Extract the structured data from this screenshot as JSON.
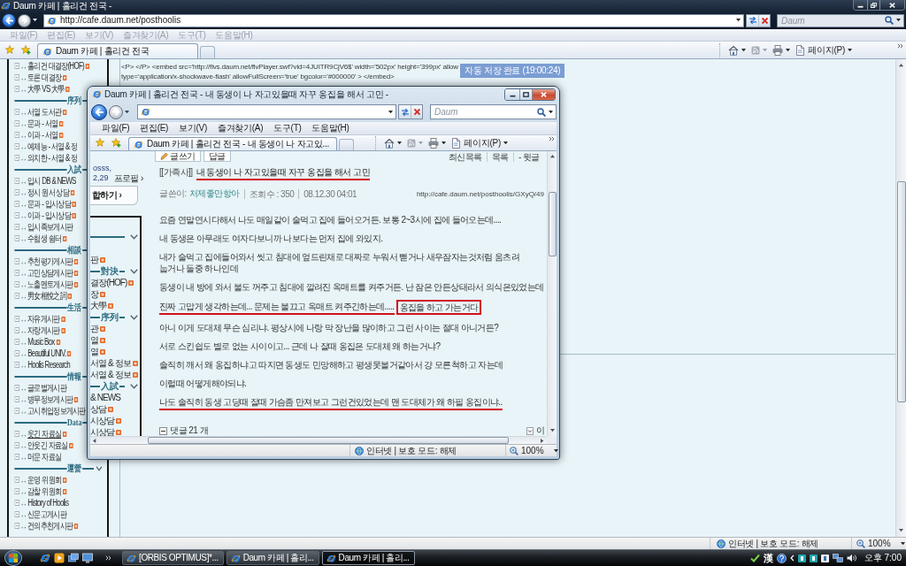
{
  "outer_window": {
    "title": "Daum 카페 | 홀리건 전국 -",
    "active": false,
    "address": "http://cafe.daum.net/posthoolis",
    "search_placeholder": "Daum",
    "menu": [
      "파일(F)",
      "편집(E)",
      "보기(V)",
      "즐겨찾기(A)",
      "도구(T)",
      "도움말(H)"
    ],
    "tabs": [
      {
        "label": "Daum 카페 | 홀리건 전국",
        "selected": true
      }
    ],
    "page_menu": "페이지(P)",
    "status": "인터넷 | 보호 모드: 해제",
    "zoom": "100%"
  },
  "cafe_sidebar": [
    {
      "kind": "link",
      "label": "홀리건 대결장(HOF)",
      "new": true,
      "hovered": false
    },
    {
      "kind": "link",
      "label": "토론 대결장",
      "new": true,
      "hovered": false
    },
    {
      "kind": "link",
      "label": "大學 VS 大學",
      "new": true,
      "hovered": false
    },
    {
      "kind": "section",
      "label": "序列",
      "toggle": false
    },
    {
      "kind": "link",
      "label": "서열 도서관",
      "new": true,
      "hovered": false
    },
    {
      "kind": "link",
      "label": "문과 - 서열",
      "new": true,
      "hovered": false
    },
    {
      "kind": "link",
      "label": "이과 - 서열",
      "new": true,
      "hovered": false
    },
    {
      "kind": "link",
      "label": "예체능 - 서열 & 정",
      "new": false,
      "hovered": false
    },
    {
      "kind": "link",
      "label": "의치한 - 서열 & 정",
      "new": false,
      "hovered": false
    },
    {
      "kind": "section",
      "label": "入試",
      "toggle": false
    },
    {
      "kind": "link",
      "label": "입시 DB & NEWS",
      "new": false,
      "hovered": false
    },
    {
      "kind": "link",
      "label": "정시 원서 상담",
      "new": true,
      "hovered": false
    },
    {
      "kind": "link",
      "label": "문과 - 입시상담",
      "new": true,
      "hovered": false
    },
    {
      "kind": "link",
      "label": "이과 - 입시상담",
      "new": true,
      "hovered": false
    },
    {
      "kind": "link",
      "label": "입시족보게시판",
      "new": false,
      "hovered": false
    },
    {
      "kind": "link",
      "label": "수험생 쉼터",
      "new": true,
      "hovered": false
    },
    {
      "kind": "section",
      "label": "相談",
      "toggle": false
    },
    {
      "kind": "link",
      "label": "추천평가게시판",
      "new": true,
      "hovered": false
    },
    {
      "kind": "link",
      "label": "고민상담게시판",
      "new": true,
      "hovered": false
    },
    {
      "kind": "link",
      "label": "노출멘토게시판",
      "new": true,
      "hovered": false
    },
    {
      "kind": "link",
      "label": "男女相悅之詞",
      "new": true,
      "hovered": false
    },
    {
      "kind": "section",
      "label": "生活",
      "toggle": false
    },
    {
      "kind": "link",
      "label": "자유게시판",
      "new": true,
      "hovered": false
    },
    {
      "kind": "link",
      "label": "자랑게시판",
      "new": true,
      "hovered": false
    },
    {
      "kind": "link",
      "label": "Music Box",
      "new": true,
      "hovered": false
    },
    {
      "kind": "link",
      "label": "Beautiful UNIV.",
      "new": true,
      "hovered": false
    },
    {
      "kind": "link",
      "label": "Hoolis Research",
      "new": false,
      "hovered": false
    },
    {
      "kind": "section",
      "label": "情報",
      "toggle": false
    },
    {
      "kind": "link",
      "label": "글로벌게시판",
      "new": false,
      "hovered": false
    },
    {
      "kind": "link",
      "label": "병무정보게시판",
      "new": true,
      "hovered": false
    },
    {
      "kind": "link",
      "label": "고시취업정보게시판",
      "new": false,
      "hovered": false
    },
    {
      "kind": "section",
      "label": "Data",
      "toggle": false
    },
    {
      "kind": "link",
      "label": "웃긴 자료실",
      "new": true,
      "hovered": true
    },
    {
      "kind": "link",
      "label": "안웃긴 자료실",
      "new": true,
      "hovered": false
    },
    {
      "kind": "link",
      "label": "머문 자료실",
      "new": false,
      "hovered": false
    },
    {
      "kind": "section",
      "label": "運營",
      "toggle": true
    },
    {
      "kind": "link",
      "label": "운영 위원회",
      "new": true,
      "hovered": false
    },
    {
      "kind": "link",
      "label": "감찰 위원회",
      "new": true,
      "hovered": false
    },
    {
      "kind": "link",
      "label": "History of Hoolis",
      "new": false,
      "hovered": false
    },
    {
      "kind": "link",
      "label": "신문고게시판",
      "new": false,
      "hovered": false
    },
    {
      "kind": "link",
      "label": "건의추천게시판",
      "new": true,
      "hovered": false
    }
  ],
  "editor": {
    "code_lines": [
      "<P> </P> <embed src='http://flvs.daum.net/flvPlayer.swf?vid=4JUITR9CjV6$' width='502px' height='399px' allow",
      "type='application/x-shockwave-flash' allowFullScreen='true' bgcolor='#000000' > </embed>"
    ],
    "autosave_notice": "자동 저장 완료 (19:00:24)"
  },
  "popup_window": {
    "title": "Daum 카페 | 홀리건 전국 - 내 동생이 나 자고있을때 자꾸 옹집을 해서 고민 -",
    "active": true,
    "search_placeholder": "Daum",
    "menu": [
      "파일(F)",
      "편집(E)",
      "보기(V)",
      "즐겨찾기(A)",
      "도구(T)",
      "도움말(H)"
    ],
    "tabs": [
      {
        "label": "Daum 카페 | 홀리건 전국 - 내 동생이 나 자고있...",
        "selected": true
      }
    ],
    "page_menu": "페이지(P)",
    "sidebar": {
      "info_text": "osss,",
      "count_text": "2,29",
      "profile_link": "프로필 ›",
      "join_button": "합하기 ›",
      "menu": [
        {
          "kind": "section",
          "toggle": true
        },
        {
          "kind": "link",
          "label": "판",
          "new": true
        },
        {
          "kind": "section",
          "label": "對決",
          "toggle": true
        },
        {
          "kind": "link",
          "label": "결장(HOF)",
          "new": true
        },
        {
          "kind": "link",
          "label": "장",
          "new": true
        },
        {
          "kind": "link",
          "label": "大學",
          "new": true
        },
        {
          "kind": "section",
          "label": "序列",
          "toggle": true
        },
        {
          "kind": "link",
          "label": "관",
          "new": true
        },
        {
          "kind": "link",
          "label": "열",
          "new": true
        },
        {
          "kind": "link",
          "label": "열",
          "new": true
        },
        {
          "kind": "link",
          "label": "서열 & 정보",
          "new": true
        },
        {
          "kind": "link",
          "label": "서열 & 정보",
          "new": true
        },
        {
          "kind": "section",
          "label": "入試",
          "toggle": true
        },
        {
          "kind": "link",
          "label": "& NEWS",
          "new": false
        },
        {
          "kind": "link",
          "label": "상담",
          "new": true
        },
        {
          "kind": "link",
          "label": "시상담",
          "new": true
        },
        {
          "kind": "link",
          "label": "시상담",
          "new": true
        }
      ]
    },
    "post": {
      "actions": [
        {
          "kind": "write",
          "label": "글쓰기"
        },
        {
          "kind": "reply",
          "label": "답글"
        }
      ],
      "nav_links": [
        "최신목록",
        "목록",
        "- 윗글"
      ],
      "category": "[[가족사]]",
      "title": "내 동생이 나 자고있을때 자꾸 옹집을 해서 고민",
      "title_underlined": true,
      "author_label": "글쓴이:",
      "author": "처제좋만항아",
      "views": "조회수 : 350",
      "date": "08.12.30 04:01",
      "url": "http://cafe.daum.net/posthoolis/GXyQ/49",
      "paragraphs": [
        {
          "segments": [
            {
              "text": "요즘 연말연시다해서 나도 매일같이 술먹고 집에 들어오거든. 보통 2~3시에 집에 들어오는데...."
            }
          ]
        },
        {
          "segments": [
            {
              "text": "내 동생은 아무래도 여자다보니까 나보다는 먼저 집에 와있지."
            }
          ]
        },
        {
          "segments": [
            {
              "text": "내가 술먹고 집에들어와서 씻고 침대에 엎드린채로 대짜로 누워서 뻗거나 새우잠자는것처럼 움츠려 눕거나 둘중 하나인데"
            }
          ]
        },
        {
          "segments": [
            {
              "text": "동생이 내 방에 와서 불도 꺼주고 침대에 깔려진 옥매트를 켜주거든. 난 잠은 안든상태라서 의식은있었는데"
            }
          ]
        },
        {
          "segments": [
            {
              "text": "진짜 고맙게 생각하는데... 문제는 불끄고 옥매트 켜주긴하는데.....",
              "underlined": true
            },
            {
              "text": "옹집을 하고 가는거다",
              "boxed": true
            }
          ]
        },
        {
          "segments": [
            {
              "text": "아니 이게 도대체 무슨 심리냐. 평상시에 나랑 막 장난을 많이하고 그런 사이는 절대 아니거든?"
            }
          ]
        },
        {
          "segments": [
            {
              "text": "서로 스킨쉽도 별로 없는 사이이고... 근데 나 잘때 옹집은 도대체 왜 하는거냐?"
            }
          ]
        },
        {
          "segments": [
            {
              "text": "솔직히 깨서 왜 옹집하냐고 따지면 동생도 민망해하고 평생못볼거같아서 걍 모른척하고 자는데"
            }
          ]
        },
        {
          "segments": [
            {
              "text": "이럴때 어떻게해야되냐."
            }
          ]
        },
        {
          "segments": [
            {
              "text": "나도 솔직히 동생 고딩때 잘때 가슴좀 만져보고 그런건있었는데 맨 도대체가 왜 하필 옹집이냐..",
              "underlined": true
            }
          ]
        }
      ],
      "comments": "댓글 21 개",
      "next_link": "이"
    },
    "status": "인터넷 | 보호 모드: 해제",
    "zoom": "100%"
  },
  "taskbar": {
    "buttons": [
      {
        "label": "[ORBIS OPTIMUS]*...",
        "selected": false
      },
      {
        "label": "Daum 카페 | 홀리...",
        "selected": false
      },
      {
        "label": "Daum 카페 | 홀리...",
        "selected": true
      }
    ],
    "ime_mode": "漢",
    "clock": "오후 7:00"
  }
}
